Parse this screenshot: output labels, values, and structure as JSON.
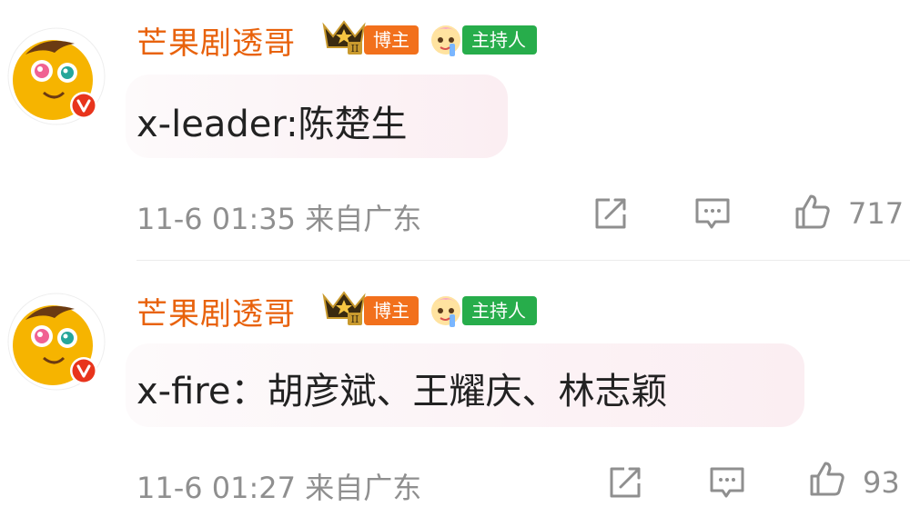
{
  "comments": [
    {
      "username": "芒果剧透哥",
      "badge_blogger": "博主",
      "badge_host": "主持人",
      "text": "x-leader:陈楚生",
      "time": "11-6 01:35",
      "location": "来自广东",
      "likes": "717"
    },
    {
      "username": "芒果剧透哥",
      "badge_blogger": "博主",
      "badge_host": "主持人",
      "text": "x-fire：胡彦斌、王耀庆、林志颖",
      "time": "11-6 01:27",
      "location": "来自广东",
      "likes": "93"
    }
  ],
  "colors": {
    "username": "#e8620c",
    "blogger_badge": "#f2701c",
    "host_badge": "#27ad4b",
    "meta_text": "#8f8f8f",
    "avatar_face": "#f6b400",
    "verified_badge": "#e8341c"
  },
  "icons": [
    "crown-level-icon",
    "host-icon",
    "share-icon",
    "comment-icon",
    "like-icon",
    "verified-v-icon"
  ]
}
